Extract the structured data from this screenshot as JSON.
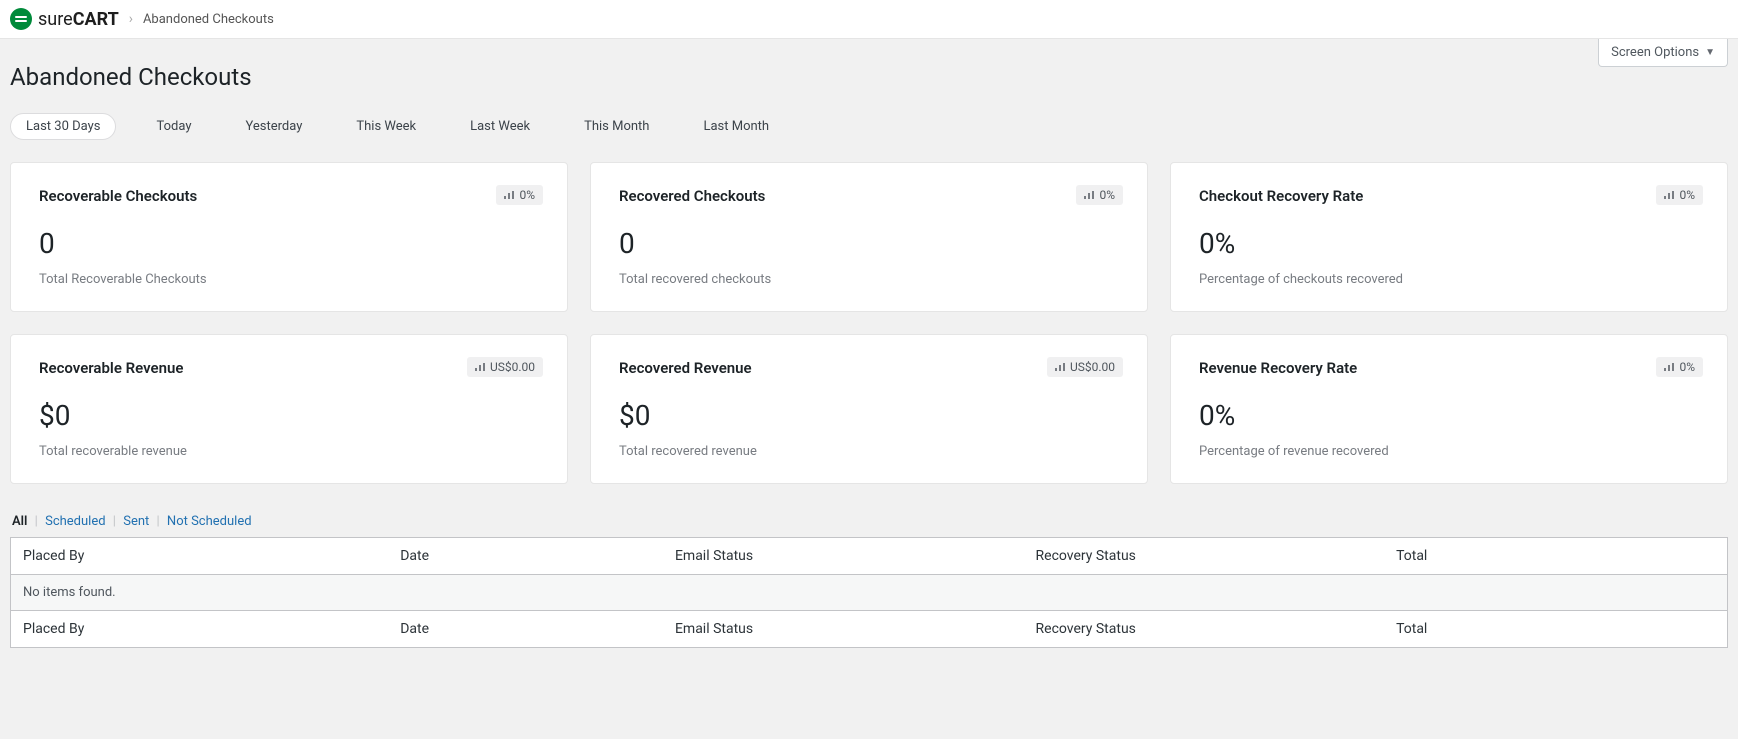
{
  "header": {
    "brand_prefix": "sure",
    "brand_bold": "CART",
    "breadcrumb": "Abandoned Checkouts"
  },
  "screen_options_label": "Screen Options",
  "page_title": "Abandoned Checkouts",
  "range_tabs": [
    "Last 30 Days",
    "Today",
    "Yesterday",
    "This Week",
    "Last Week",
    "This Month",
    "Last Month"
  ],
  "cards": [
    {
      "title": "Recoverable Checkouts",
      "value": "0",
      "sub": "Total Recoverable Checkouts",
      "badge": "0%"
    },
    {
      "title": "Recovered Checkouts",
      "value": "0",
      "sub": "Total recovered checkouts",
      "badge": "0%"
    },
    {
      "title": "Checkout Recovery Rate",
      "value": "0%",
      "sub": "Percentage of checkouts recovered",
      "badge": "0%"
    },
    {
      "title": "Recoverable Revenue",
      "value": "$0",
      "sub": "Total recoverable revenue",
      "badge": "US$0.00"
    },
    {
      "title": "Recovered Revenue",
      "value": "$0",
      "sub": "Total recovered revenue",
      "badge": "US$0.00"
    },
    {
      "title": "Revenue Recovery Rate",
      "value": "0%",
      "sub": "Percentage of revenue recovered",
      "badge": "0%"
    }
  ],
  "filters": [
    "All",
    "Scheduled",
    "Sent",
    "Not Scheduled"
  ],
  "table": {
    "columns": [
      "Placed By",
      "Date",
      "Email Status",
      "Recovery Status",
      "Total"
    ],
    "empty": "No items found."
  }
}
